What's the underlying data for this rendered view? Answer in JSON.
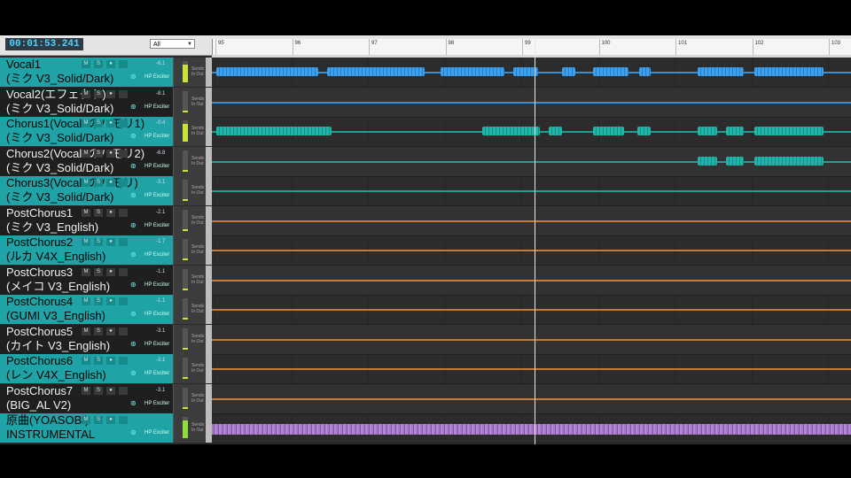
{
  "transport": {
    "time": "00:01:53.241"
  },
  "filter": {
    "value": "All"
  },
  "ruler": {
    "bars": [
      "95",
      "96",
      "97",
      "98",
      "99",
      "100",
      "101",
      "102",
      "103"
    ]
  },
  "track_ui": {
    "mute": "M",
    "solo": "S",
    "rec": "●",
    "fx_label": "HP Exciter",
    "sends": "Sends\nIn\nOut"
  },
  "tracks": [
    {
      "name": "Vocal1",
      "sub": "(ミク V3_Solid/Dark)",
      "vol": "-6.1",
      "style": "teal",
      "clip_color": "#3aa0f0"
    },
    {
      "name": "Vocal2(エフェクト)",
      "sub": "(ミク V3_Solid/Dark)",
      "vol": "-8.1",
      "style": "dark",
      "clip_color": "#3aa0f0"
    },
    {
      "name": "Chorus1(Vocal1のハモリ1)",
      "sub": "(ミク V3_Solid/Dark)",
      "vol": "-0.4",
      "style": "teal",
      "clip_color": "#1fb5a8"
    },
    {
      "name": "Chorus2(Vocal1のハモリ2)",
      "sub": "(ミク V3_Solid/Dark)",
      "vol": "-6.8",
      "style": "dark",
      "clip_color": "#1fb5a8"
    },
    {
      "name": "Chorus3(Vocal2のハモリ)",
      "sub": "(ミク V3_Solid/Dark)",
      "vol": "-3.1",
      "style": "teal",
      "clip_color": "#1fb5a8"
    },
    {
      "name": "PostChorus1",
      "sub": "(ミク V3_English)",
      "vol": "-2.1",
      "style": "dark",
      "clip_color": "#e08a3a"
    },
    {
      "name": "PostChorus2",
      "sub": "(ルカ V4X_English)",
      "vol": "-1.7",
      "style": "teal",
      "clip_color": "#e08a3a"
    },
    {
      "name": "PostChorus3",
      "sub": "(メイコ V3_English)",
      "vol": "-1.1",
      "style": "dark",
      "clip_color": "#e08a3a"
    },
    {
      "name": "PostChorus4",
      "sub": "(GUMI V3_English)",
      "vol": "-1.1",
      "style": "teal",
      "clip_color": "#e08a3a"
    },
    {
      "name": "PostChorus5",
      "sub": "(カイト V3_English)",
      "vol": "-3.1",
      "style": "dark",
      "clip_color": "#e08a3a"
    },
    {
      "name": "PostChorus6",
      "sub": "(レン V4X_English)",
      "vol": "-3.1",
      "style": "teal",
      "clip_color": "#e08a3a"
    },
    {
      "name": "PostChorus7",
      "sub": "(BIG_AL V2)",
      "vol": "-3.1",
      "style": "dark",
      "clip_color": "#e08a3a"
    },
    {
      "name": "原曲(YOASOBI)",
      "sub": "INSTRUMENTAL",
      "vol": "",
      "style": "teal",
      "clip_color": "#a879c9"
    }
  ]
}
